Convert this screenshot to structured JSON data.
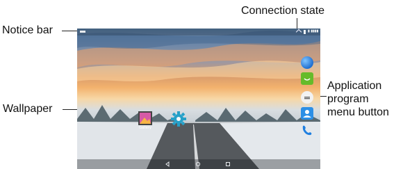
{
  "callouts": {
    "notice_bar": "Notice bar",
    "connection_state": "Connection state",
    "wallpaper": "Wallpaper",
    "app_menu_button": [
      "Application",
      "program",
      "menu button"
    ]
  },
  "screen": {
    "apps": [
      {
        "name": "gallery",
        "label": "Gallery"
      },
      {
        "name": "settings",
        "label": ""
      }
    ],
    "colors": {
      "gallery_tile": "#d65aa6",
      "settings_gear": "#26a0c8",
      "dock_globe": "#1f6fd0",
      "dock_message": "#66bb2a",
      "dock_menu": "#f2f2f2",
      "dock_contacts": "#2c8fe6",
      "dock_phone": "#1f7fe0"
    }
  }
}
